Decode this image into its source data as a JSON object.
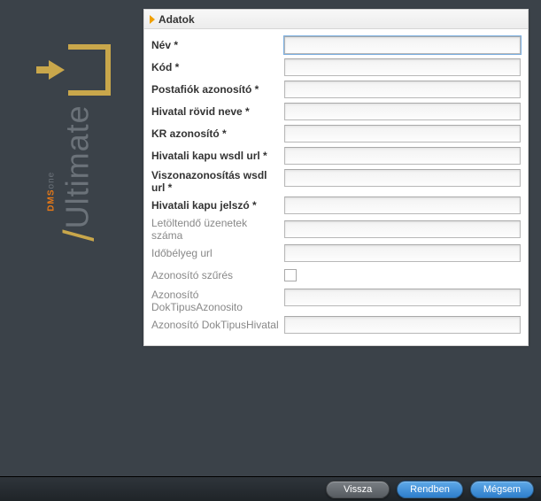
{
  "brand": {
    "product": "Ultimate",
    "sub1": "DMS",
    "sub2": "one"
  },
  "panel": {
    "title": "Adatok",
    "fields": {
      "nev": {
        "label": "Név *",
        "value": "",
        "required": true
      },
      "kod": {
        "label": "Kód *",
        "value": "",
        "required": true
      },
      "postafiok": {
        "label": "Postafiók azonosító *",
        "value": "",
        "required": true
      },
      "hivatal_rovid": {
        "label": "Hivatal rövid neve *",
        "value": "",
        "required": true
      },
      "kr_azonosito": {
        "label": "KR azonosító *",
        "value": "",
        "required": true
      },
      "wsdl_url": {
        "label": "Hivatali kapu wsdl url *",
        "value": "",
        "required": true
      },
      "viszon": {
        "label": "Viszonazonosítás wsdl url *",
        "value": "",
        "required": true
      },
      "jelszo": {
        "label": "Hivatali kapu jelszó *",
        "value": "",
        "required": true
      },
      "letoltendo": {
        "label": "Letöltendő üzenetek száma",
        "value": "",
        "required": false
      },
      "idobelyeg": {
        "label": "Időbélyeg url",
        "value": "",
        "required": false
      },
      "szures": {
        "label": "Azonosító szűrés",
        "checked": false,
        "required": false
      },
      "doktipus_azon": {
        "label": "Azonosító DokTipusAzonosito",
        "value": "",
        "required": false
      },
      "doktipus_hivatal": {
        "label": "Azonosító DokTipusHivatal",
        "value": "",
        "required": false
      }
    }
  },
  "footer": {
    "back": "Vissza",
    "ok": "Rendben",
    "cancel": "Mégsem"
  }
}
